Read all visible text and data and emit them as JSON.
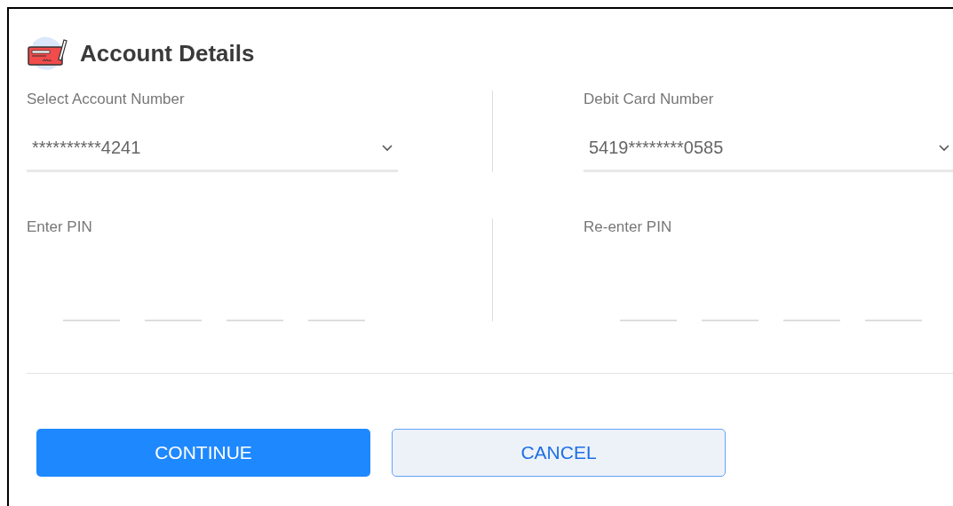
{
  "title": "Account Details",
  "selects": [
    {
      "label": "Select Account Number",
      "value": "**********4241"
    },
    {
      "label": "Debit Card Number",
      "value": "5419********0585"
    }
  ],
  "pins": [
    {
      "label": "Enter PIN"
    },
    {
      "label": "Re-enter PIN"
    }
  ],
  "buttons": [
    {
      "label": "CONTINUE",
      "kind": "primary"
    },
    {
      "label": "CANCEL",
      "kind": "secondary"
    }
  ]
}
